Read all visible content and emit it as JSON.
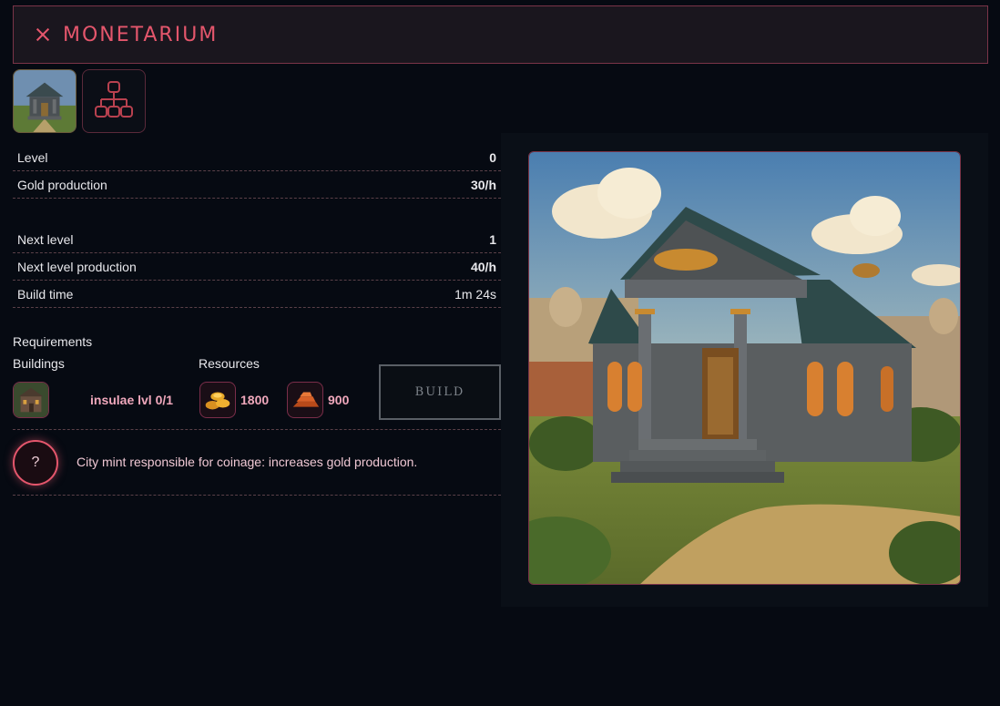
{
  "header": {
    "title": "MONETARIUM"
  },
  "tabs": [
    {
      "name": "building-image-tab",
      "icon": "building-thumbnail-icon"
    },
    {
      "name": "tech-tree-tab",
      "icon": "hierarchy-icon"
    }
  ],
  "stats": {
    "level_label": "Level",
    "level_value": "0",
    "gold_label": "Gold production",
    "gold_value": "30/h",
    "next_level_label": "Next level",
    "next_level_value": "1",
    "next_prod_label": "Next level production",
    "next_prod_value": "40/h",
    "build_time_label": "Build time",
    "build_time_value": "1m 24s"
  },
  "requirements": {
    "title": "Requirements",
    "buildings_label": "Buildings",
    "resources_label": "Resources",
    "building_req": "insulae lvl 0/1",
    "gold_amount": "1800",
    "copper_amount": "900"
  },
  "build_button": "BUILD",
  "description": "City mint responsible for coinage: increases gold production.",
  "help_symbol": "?",
  "colors": {
    "accent": "#e4566c",
    "background": "#060a12",
    "header_bg": "#1a161e"
  }
}
